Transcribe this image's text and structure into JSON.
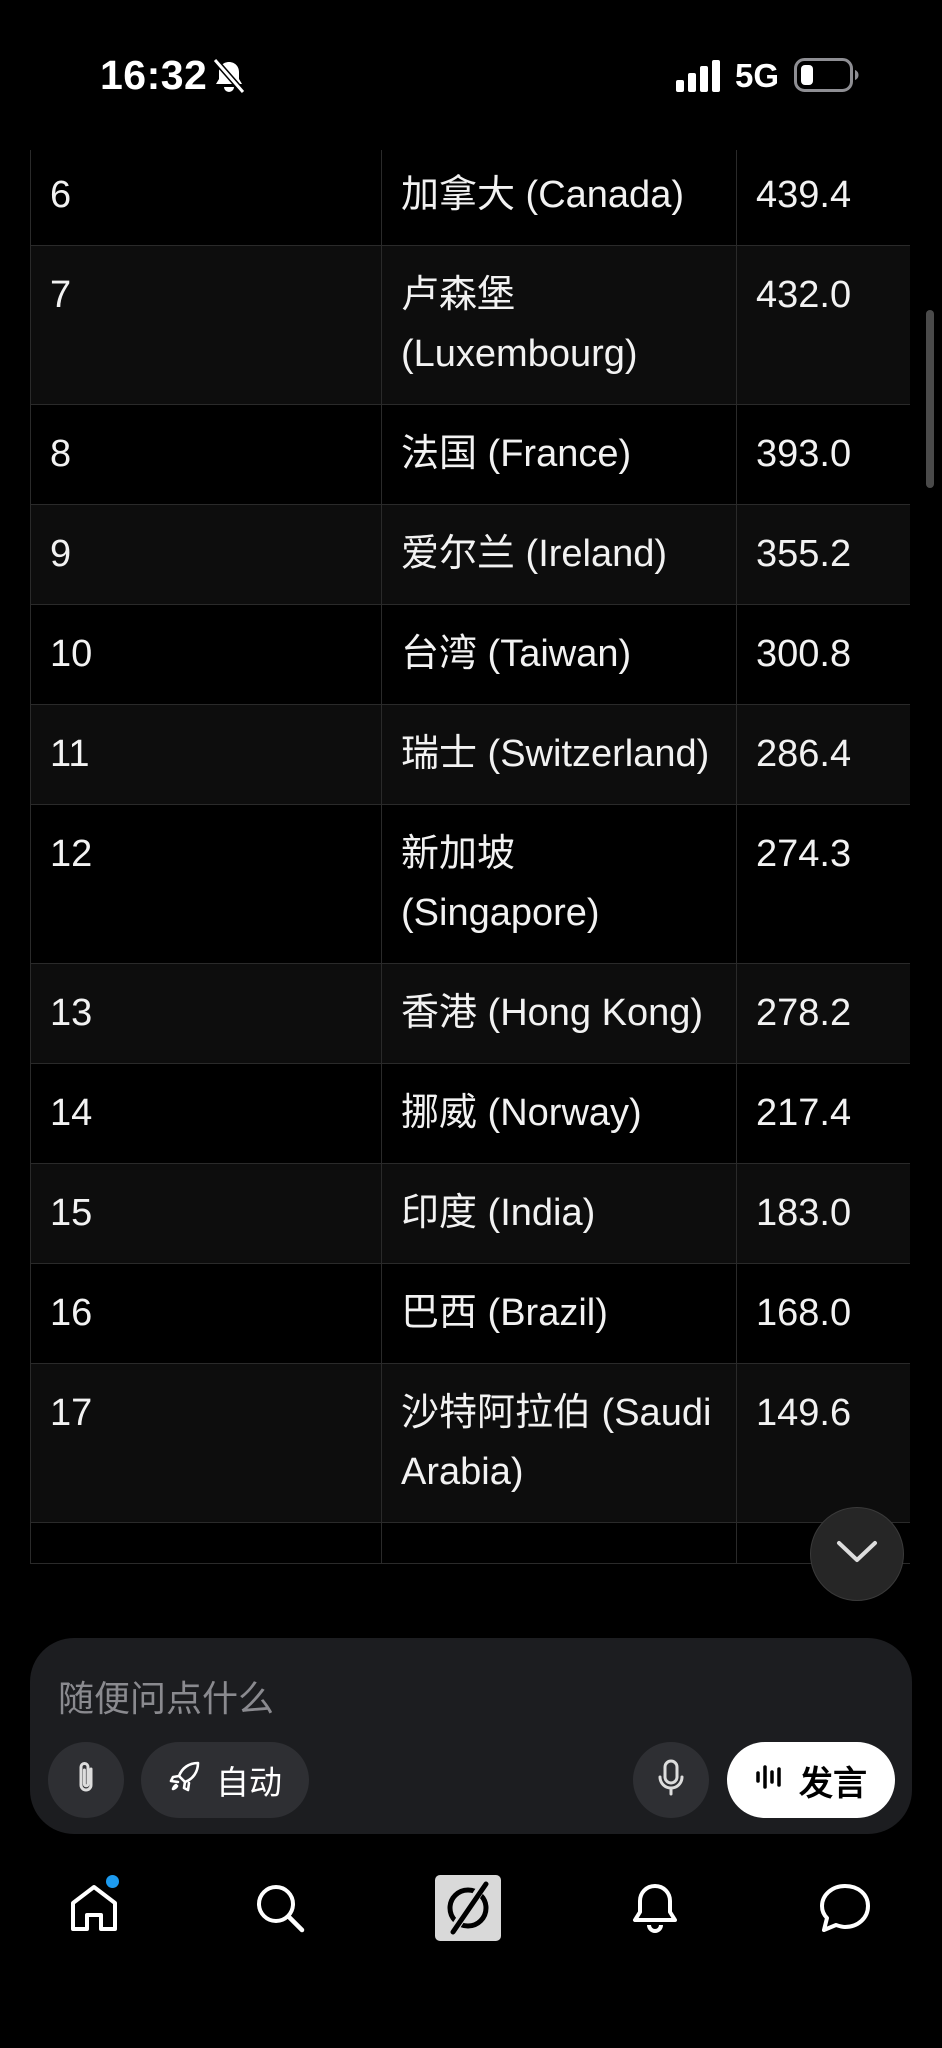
{
  "status_bar": {
    "time": "16:32",
    "network": "5G"
  },
  "table": {
    "rows": [
      {
        "rank": "6",
        "country": "加拿大 (Canada)",
        "value": "439.4"
      },
      {
        "rank": "7",
        "country": "卢森堡 (Luxembourg)",
        "value": "432.0"
      },
      {
        "rank": "8",
        "country": "法国 (France)",
        "value": "393.0"
      },
      {
        "rank": "9",
        "country": "爱尔兰 (Ireland)",
        "value": "355.2"
      },
      {
        "rank": "10",
        "country": "台湾 (Taiwan)",
        "value": "300.8"
      },
      {
        "rank": "11",
        "country": "瑞士 (Switzerland)",
        "value": "286.4"
      },
      {
        "rank": "12",
        "country": "新加坡 (Singapore)",
        "value": "274.3"
      },
      {
        "rank": "13",
        "country": "香港 (Hong Kong)",
        "value": "278.2"
      },
      {
        "rank": "14",
        "country": "挪威 (Norway)",
        "value": "217.4"
      },
      {
        "rank": "15",
        "country": "印度 (India)",
        "value": "183.0"
      },
      {
        "rank": "16",
        "country": "巴西 (Brazil)",
        "value": "168.0"
      },
      {
        "rank": "17",
        "country": "沙特阿拉伯 (Saudi Arabia)",
        "value": "149.6"
      },
      {
        "rank": "",
        "country": "",
        "value": ""
      }
    ]
  },
  "composer": {
    "placeholder": "随便问点什么",
    "mode_label": "自动",
    "send_label": "发言"
  },
  "nav": {
    "items": [
      "home-icon",
      "search-icon",
      "grok-icon",
      "bell-icon",
      "chat-icon"
    ],
    "home_has_notification": true
  },
  "colors": {
    "background": "#000000",
    "notification_dot": "#1d9bf0",
    "composer_bg": "#1c1d20"
  }
}
